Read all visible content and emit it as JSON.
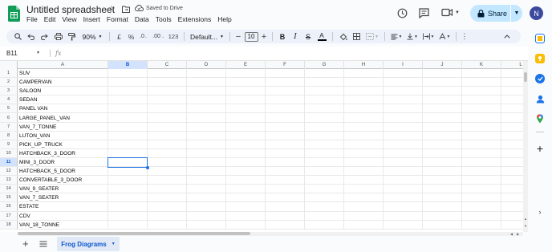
{
  "doc": {
    "title": "Untitled spreadsheet",
    "saved_status": "Saved to Drive"
  },
  "menu": [
    "File",
    "Edit",
    "View",
    "Insert",
    "Format",
    "Data",
    "Tools",
    "Extensions",
    "Help"
  ],
  "header": {
    "share_label": "Share",
    "avatar_letter": "N"
  },
  "toolbar": {
    "zoom": "90%",
    "currency": "£",
    "percent": "%",
    "decrease_decimal": ".0",
    "increase_decimal": ".00",
    "number_format": "123",
    "font_family": "Default...",
    "font_size": "10",
    "bold": "B",
    "italic": "I",
    "strikethrough": "S",
    "text_color": "A"
  },
  "formula_bar": {
    "cell_ref": "B11",
    "fx": "fx",
    "value": ""
  },
  "grid": {
    "columns": [
      "A",
      "B",
      "C",
      "D",
      "E",
      "F",
      "G",
      "H",
      "I",
      "J",
      "K",
      "L"
    ],
    "selected_column": "B",
    "selected_row": "11",
    "rows": [
      {
        "num": "1",
        "a": "SUV"
      },
      {
        "num": "2",
        "a": "CAMPERVAN"
      },
      {
        "num": "3",
        "a": "SALOON"
      },
      {
        "num": "4",
        "a": "SEDAN"
      },
      {
        "num": "5",
        "a": "PANEL VAN"
      },
      {
        "num": "6",
        "a": "LARGE_PANEL_VAN"
      },
      {
        "num": "7",
        "a": "VAN_7_TONNE"
      },
      {
        "num": "8",
        "a": "LUTON_VAN"
      },
      {
        "num": "9",
        "a": "PICK_UP_TRUCK"
      },
      {
        "num": "10",
        "a": "HATCHBACK_3_DOOR"
      },
      {
        "num": "11",
        "a": "MINI_3_DOOR"
      },
      {
        "num": "12",
        "a": "HATCHBACK_5_DOOR"
      },
      {
        "num": "13",
        "a": "CONVERTABLE_3_DOOR"
      },
      {
        "num": "14",
        "a": "VAN_9_SEATER"
      },
      {
        "num": "15",
        "a": "VAN_7_SEATER"
      },
      {
        "num": "16",
        "a": "ESTATE"
      },
      {
        "num": "17",
        "a": "CDV"
      },
      {
        "num": "18",
        "a": "VAN_18_TONNE"
      }
    ]
  },
  "bottom": {
    "sheet_name": "Frog Diagrams"
  },
  "colors": {
    "accent": "#1a73e8",
    "share_bg": "#c2e7ff",
    "sheet_tab_bg": "#e1e9f7",
    "logo_green": "#0f9d58"
  }
}
